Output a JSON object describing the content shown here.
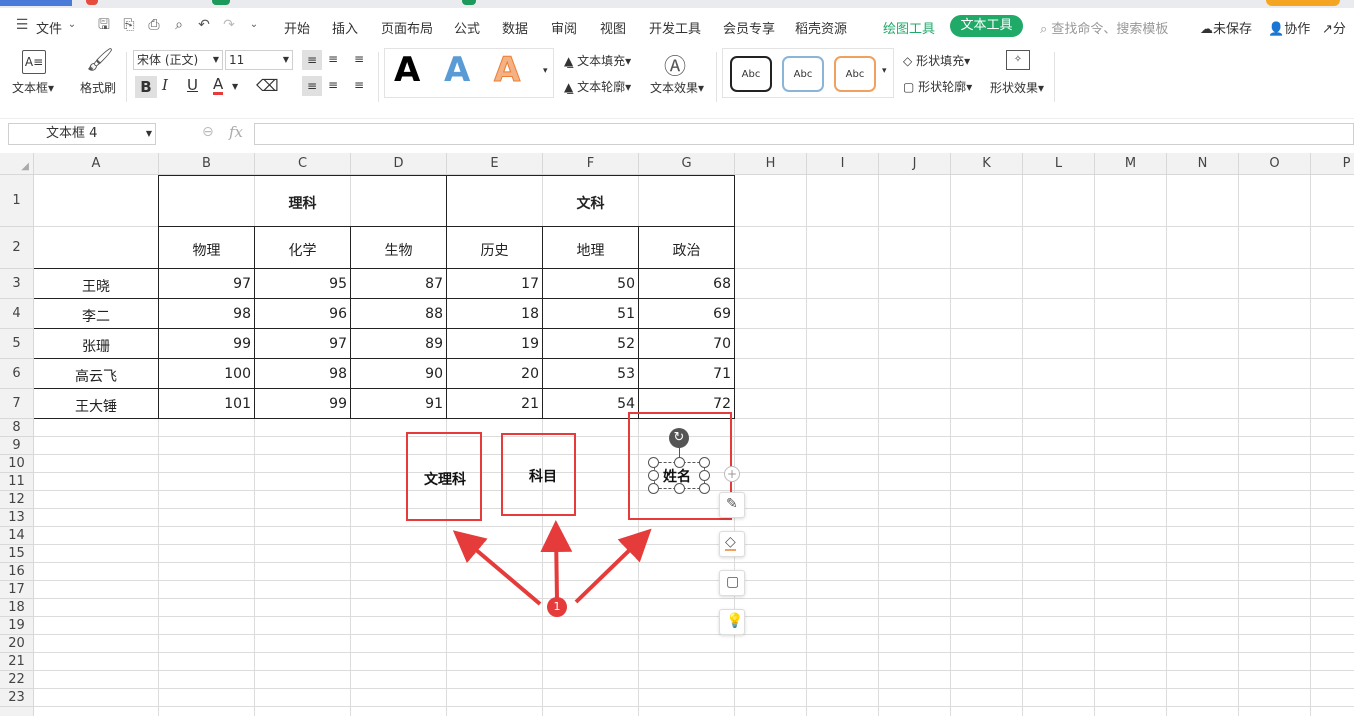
{
  "menu": {
    "file": "文件",
    "tabs": [
      "开始",
      "插入",
      "页面布局",
      "公式",
      "数据",
      "审阅",
      "视图",
      "开发工具",
      "会员专享",
      "稻壳资源"
    ],
    "drawing_tools": "绘图工具",
    "text_tools": "文本工具",
    "search_placeholder": "查找命令、搜索模板",
    "unsaved": "未保存",
    "collab": "协作",
    "share": "分"
  },
  "toolbar": {
    "textbox": "文本框",
    "format_painter": "格式刷",
    "font_name": "宋体 (正文)",
    "font_size": "11",
    "bold": "B",
    "italic": "I",
    "underline": "U",
    "font_color": "A",
    "text_fill": "文本填充",
    "text_outline": "文本轮廓",
    "text_effect": "文本效果",
    "shape_fill": "形状填充",
    "shape_outline": "形状轮廓",
    "shape_effect": "形状效果",
    "style_letter": "A",
    "abc": "Abc"
  },
  "formula_bar": {
    "name_box": "文本框 4",
    "fx": "fx",
    "formula": ""
  },
  "columns": [
    "A",
    "B",
    "C",
    "D",
    "E",
    "F",
    "G",
    "H",
    "I",
    "J",
    "K",
    "L",
    "M",
    "N",
    "O",
    "P"
  ],
  "rows": [
    "1",
    "2",
    "3",
    "4",
    "5",
    "6",
    "7",
    "8",
    "9",
    "10",
    "11",
    "12",
    "13",
    "14",
    "15",
    "16",
    "17",
    "18",
    "19",
    "20",
    "21",
    "22",
    "23"
  ],
  "table": {
    "group_science": "理科",
    "group_arts": "文科",
    "subjects": [
      "物理",
      "化学",
      "生物",
      "历史",
      "地理",
      "政治"
    ],
    "students": [
      {
        "name": "王晓",
        "scores": [
          "97",
          "95",
          "87",
          "17",
          "50",
          "68"
        ]
      },
      {
        "name": "李二",
        "scores": [
          "98",
          "96",
          "88",
          "18",
          "51",
          "69"
        ]
      },
      {
        "name": "张珊",
        "scores": [
          "99",
          "97",
          "89",
          "19",
          "52",
          "70"
        ]
      },
      {
        "name": "高云飞",
        "scores": [
          "100",
          "98",
          "90",
          "20",
          "53",
          "71"
        ]
      },
      {
        "name": "王大锤",
        "scores": [
          "101",
          "99",
          "91",
          "21",
          "54",
          "72"
        ]
      }
    ]
  },
  "textboxes": {
    "tb1": "文理科",
    "tb2": "科目",
    "tb3": "姓名"
  },
  "annotation": {
    "badge": "1"
  },
  "colors": {
    "accent_green": "#1faa68",
    "highlight_red": "#e53b3b"
  }
}
